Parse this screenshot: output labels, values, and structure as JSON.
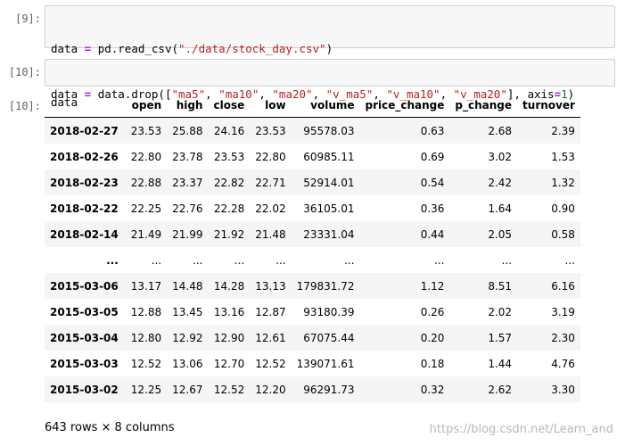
{
  "cells": [
    {
      "prompt": "[9]:",
      "code_lines": [
        [
          {
            "t": "data",
            "c": ""
          },
          {
            "t": " = ",
            "c": "kw-op"
          },
          {
            "t": "pd.read_csv(",
            "c": ""
          },
          {
            "t": "\"./data/stock_day.csv\"",
            "c": "str"
          },
          {
            "t": ")",
            "c": ""
          }
        ],
        [
          {
            "t": "data",
            "c": ""
          },
          {
            "t": " = ",
            "c": "kw-op"
          },
          {
            "t": "data.drop([",
            "c": ""
          },
          {
            "t": "\"ma5\"",
            "c": "str"
          },
          {
            "t": ", ",
            "c": ""
          },
          {
            "t": "\"ma10\"",
            "c": "str"
          },
          {
            "t": ", ",
            "c": ""
          },
          {
            "t": "\"ma20\"",
            "c": "str"
          },
          {
            "t": ", ",
            "c": ""
          },
          {
            "t": "\"v_ma5\"",
            "c": "str"
          },
          {
            "t": ", ",
            "c": ""
          },
          {
            "t": "\"v_ma10\"",
            "c": "str"
          },
          {
            "t": ", ",
            "c": ""
          },
          {
            "t": "\"v_ma20\"",
            "c": "str"
          },
          {
            "t": "], axis",
            "c": ""
          },
          {
            "t": "=",
            "c": "kw-op"
          },
          {
            "t": "1",
            "c": "num"
          },
          {
            "t": ")",
            "c": ""
          }
        ]
      ]
    },
    {
      "prompt": "[10]:",
      "code_lines": [
        [
          {
            "t": "data",
            "c": ""
          }
        ]
      ]
    }
  ],
  "output": {
    "prompt": "[10]:",
    "columns": [
      "",
      "open",
      "high",
      "close",
      "low",
      "volume",
      "price_change",
      "p_change",
      "turnover"
    ],
    "rows": [
      [
        "2018-02-27",
        "23.53",
        "25.88",
        "24.16",
        "23.53",
        "95578.03",
        "0.63",
        "2.68",
        "2.39"
      ],
      [
        "2018-02-26",
        "22.80",
        "23.78",
        "23.53",
        "22.80",
        "60985.11",
        "0.69",
        "3.02",
        "1.53"
      ],
      [
        "2018-02-23",
        "22.88",
        "23.37",
        "22.82",
        "22.71",
        "52914.01",
        "0.54",
        "2.42",
        "1.32"
      ],
      [
        "2018-02-22",
        "22.25",
        "22.76",
        "22.28",
        "22.02",
        "36105.01",
        "0.36",
        "1.64",
        "0.90"
      ],
      [
        "2018-02-14",
        "21.49",
        "21.99",
        "21.92",
        "21.48",
        "23331.04",
        "0.44",
        "2.05",
        "0.58"
      ],
      [
        "...",
        "...",
        "...",
        "...",
        "...",
        "...",
        "...",
        "...",
        "..."
      ],
      [
        "2015-03-06",
        "13.17",
        "14.48",
        "14.28",
        "13.13",
        "179831.72",
        "1.12",
        "8.51",
        "6.16"
      ],
      [
        "2015-03-05",
        "12.88",
        "13.45",
        "13.16",
        "12.87",
        "93180.39",
        "0.26",
        "2.02",
        "3.19"
      ],
      [
        "2015-03-04",
        "12.80",
        "12.92",
        "12.90",
        "12.61",
        "67075.44",
        "0.20",
        "1.57",
        "2.30"
      ],
      [
        "2015-03-03",
        "12.52",
        "13.06",
        "12.70",
        "12.52",
        "139071.61",
        "0.18",
        "1.44",
        "4.76"
      ],
      [
        "2015-03-02",
        "12.25",
        "12.67",
        "12.52",
        "12.20",
        "96291.73",
        "0.32",
        "2.62",
        "3.30"
      ]
    ],
    "shape_text": "643 rows × 8 columns"
  },
  "watermark": "https://blog.csdn.net/Learn_and"
}
